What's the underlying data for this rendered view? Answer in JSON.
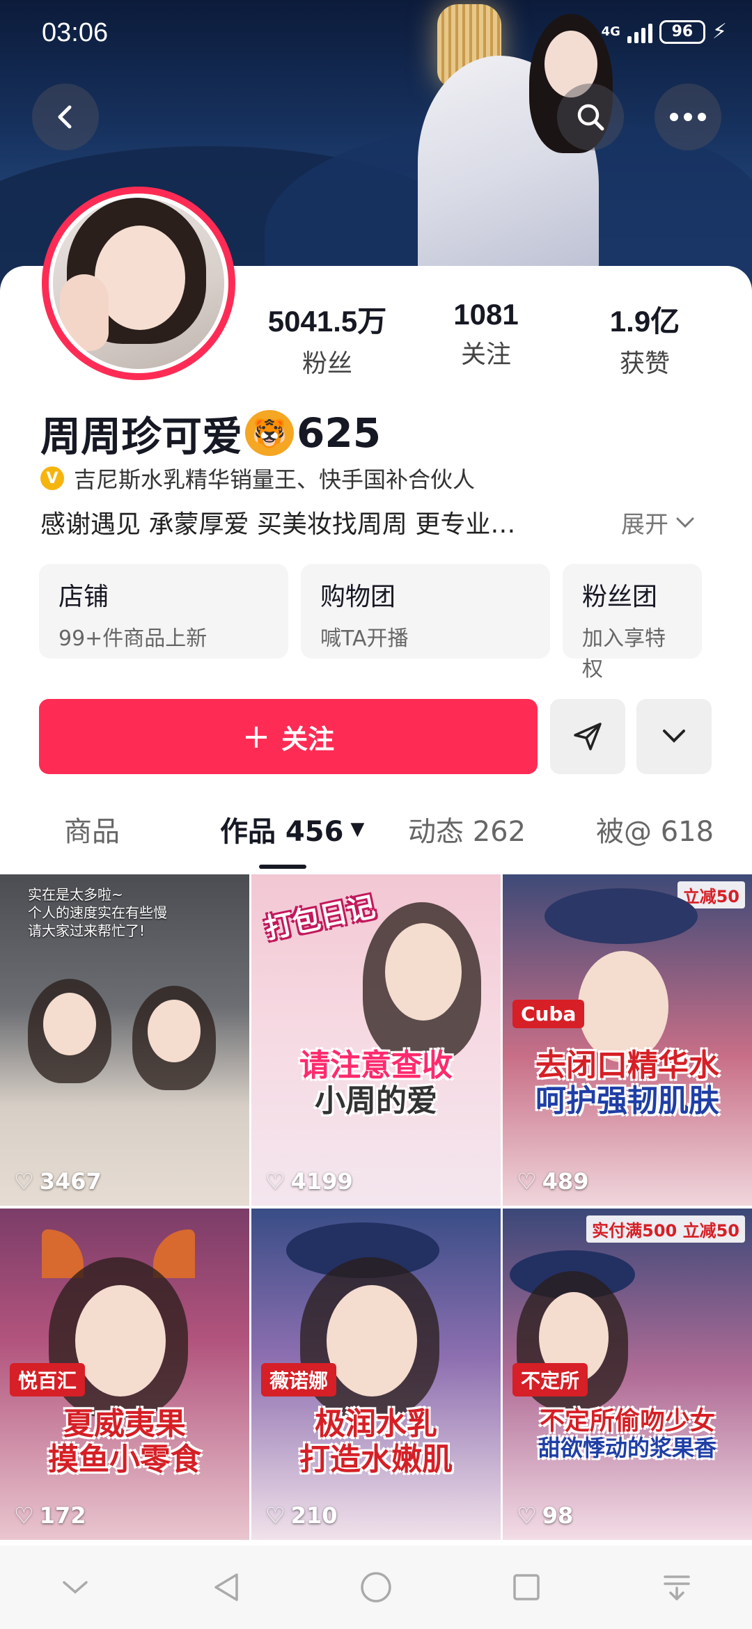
{
  "status_bar": {
    "time": "03:06",
    "network": "4G",
    "battery": "96"
  },
  "header": {
    "back_icon": "chevron-left-icon",
    "search_icon": "search-icon",
    "more_icon": "more-dots-icon"
  },
  "profile": {
    "nickname": "周周珍可爱",
    "nickname_suffix": "625",
    "nickname_emoji": "🐯",
    "verification": "吉尼斯水乳精华销量王、快手国补合伙人",
    "verify_badge": "V",
    "bio": "感谢遇见 承蒙厚爱 买美妆找周周 更专业…",
    "expand_label": "展开"
  },
  "stats": [
    {
      "value": "5041.5万",
      "label": "粉丝"
    },
    {
      "value": "1081",
      "label": "关注"
    },
    {
      "value": "1.9亿",
      "label": "获赞"
    }
  ],
  "quick_cards": [
    {
      "title": "店铺",
      "subtitle": "99+件商品上新"
    },
    {
      "title": "购物团",
      "subtitle": "喊TA开播"
    },
    {
      "title": "粉丝团",
      "subtitle": "加入享特权"
    }
  ],
  "actions": {
    "follow_label": "关注",
    "follow_plus": "+"
  },
  "tabs": [
    {
      "label": "商品"
    },
    {
      "label": "作品 456"
    },
    {
      "label": "动态 262"
    },
    {
      "label": "被@ 618"
    }
  ],
  "videos": [
    {
      "likes": "3467",
      "note_line1": "实在是太多啦~",
      "note_line2": "个人的速度实在有些慢",
      "note_line3": "请大家过来帮忙了!"
    },
    {
      "likes": "4199",
      "sticker": "打包日记",
      "caption_line1": "请注意查收",
      "caption_line2": "小周的爱"
    },
    {
      "likes": "489",
      "tag": "Cuba",
      "promo": "立减50",
      "caption_line1": "去闭口精华水",
      "caption_line2": "呵护强韧肌肤"
    },
    {
      "likes": "172",
      "tag": "悦百汇",
      "caption_line1": "夏威夷果",
      "caption_line2": "摸鱼小零食"
    },
    {
      "likes": "210",
      "tag": "薇诺娜",
      "caption_line1": "极润水乳",
      "caption_line2": "打造水嫩肌"
    },
    {
      "likes": "98",
      "tag": "不定所",
      "promo": "实付满500 立减50",
      "caption_line1": "不定所偷吻少女",
      "caption_line2": "甜欲悸动的浆果香"
    }
  ],
  "colors": {
    "accent": "#fe2c55",
    "verify": "#f6b40e"
  }
}
